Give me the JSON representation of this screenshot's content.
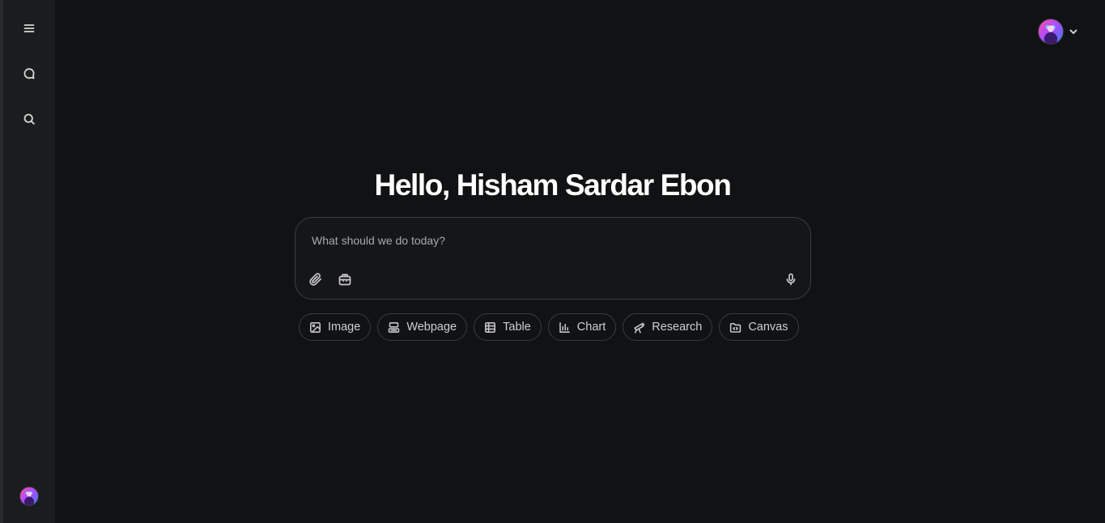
{
  "sidebar": {
    "items": [
      {
        "name": "menu-icon"
      },
      {
        "name": "chat-icon"
      },
      {
        "name": "search-icon"
      }
    ]
  },
  "header": {
    "avatar": "user-avatar",
    "dropdown_icon": "chevron-down-icon"
  },
  "main": {
    "greeting": "Hello, Hisham Sardar Ebon",
    "composer": {
      "placeholder": "What should we do today?",
      "value": ""
    },
    "chips": [
      {
        "label": "Image",
        "icon": "image-icon"
      },
      {
        "label": "Webpage",
        "icon": "webpage-icon"
      },
      {
        "label": "Table",
        "icon": "table-icon"
      },
      {
        "label": "Chart",
        "icon": "chart-icon"
      },
      {
        "label": "Research",
        "icon": "telescope-icon"
      },
      {
        "label": "Canvas",
        "icon": "folder-code-icon"
      }
    ]
  },
  "colors": {
    "background": "#111213",
    "sidebar": "#1b1c1e",
    "text": "#ffffff",
    "border": "#3d3e42"
  }
}
